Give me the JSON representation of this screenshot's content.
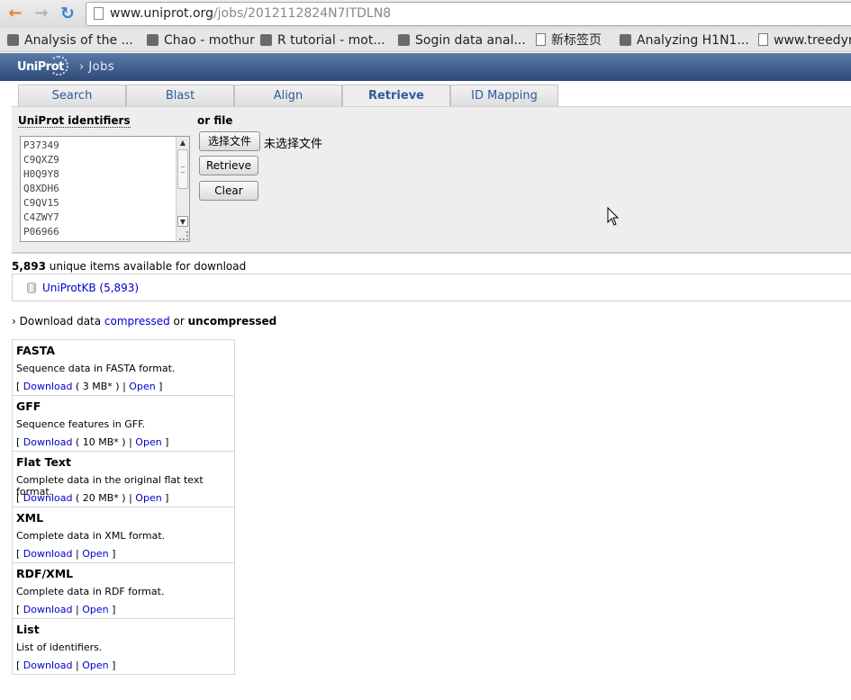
{
  "browser": {
    "url_host": "www.uniprot.org",
    "url_path": "/jobs/2012112824N7ITDLN8"
  },
  "bookmarks": [
    {
      "label": "Analysis of the ...",
      "icon": "apple-icon"
    },
    {
      "label": "Chao - mothur",
      "icon": "apple-icon"
    },
    {
      "label": "R tutorial - mot...",
      "icon": "apple-icon"
    },
    {
      "label": "Sogin data anal...",
      "icon": "apple-icon"
    },
    {
      "label": "新标签页",
      "icon": "page-icon"
    },
    {
      "label": "Analyzing H1N1...",
      "icon": "apple-icon"
    },
    {
      "label": "www.treedyn",
      "icon": "page-icon"
    }
  ],
  "header": {
    "logo": "UniProt",
    "breadcrumb": "› Jobs"
  },
  "tabs": [
    {
      "label": "Search"
    },
    {
      "label": "Blast"
    },
    {
      "label": "Align"
    },
    {
      "label": "Retrieve",
      "active": true
    },
    {
      "label": "ID Mapping"
    }
  ],
  "retrieve": {
    "ids_label": "UniProt identifiers",
    "file_label": "or file",
    "identifiers": "P37349\nC9QXZ9\nH0Q9Y8\nQ8XDH6\nC9QV15\nC4ZWY7\nP06966",
    "choose_file_button": "选择文件",
    "no_file_text": "未选择文件",
    "retrieve_button": "Retrieve",
    "clear_button": "Clear"
  },
  "results": {
    "count": "5,893",
    "count_suffix": " unique items available for download",
    "db_link": "UniProtKB (5,893)",
    "download_prefix": "› Download data ",
    "compressed": "compressed",
    "or": " or ",
    "uncompressed": "uncompressed"
  },
  "formats": [
    {
      "title": "FASTA",
      "desc": "Sequence data in FASTA format.",
      "size": " ( 3 MB* ) ",
      "download": "Download",
      "open": "Open"
    },
    {
      "title": "GFF",
      "desc": "Sequence features in GFF.",
      "size": " ( 10 MB* ) ",
      "download": "Download",
      "open": "Open"
    },
    {
      "title": "Flat Text",
      "desc": "Complete data in the original flat text format.",
      "size": " ( 20 MB* ) ",
      "download": "Download",
      "open": "Open"
    },
    {
      "title": "XML",
      "desc": "Complete data in XML format.",
      "size": " ",
      "download": "Download",
      "open": "Open"
    },
    {
      "title": "RDF/XML",
      "desc": "Complete data in RDF format.",
      "size": " ",
      "download": "Download",
      "open": "Open"
    },
    {
      "title": "List",
      "desc": "List of identifiers.",
      "size": " ",
      "download": "Download",
      "open": "Open"
    }
  ],
  "colors": {
    "header_bg": "#2e4a78",
    "tab_text": "#2e5a9a",
    "link": "#0000cc"
  }
}
